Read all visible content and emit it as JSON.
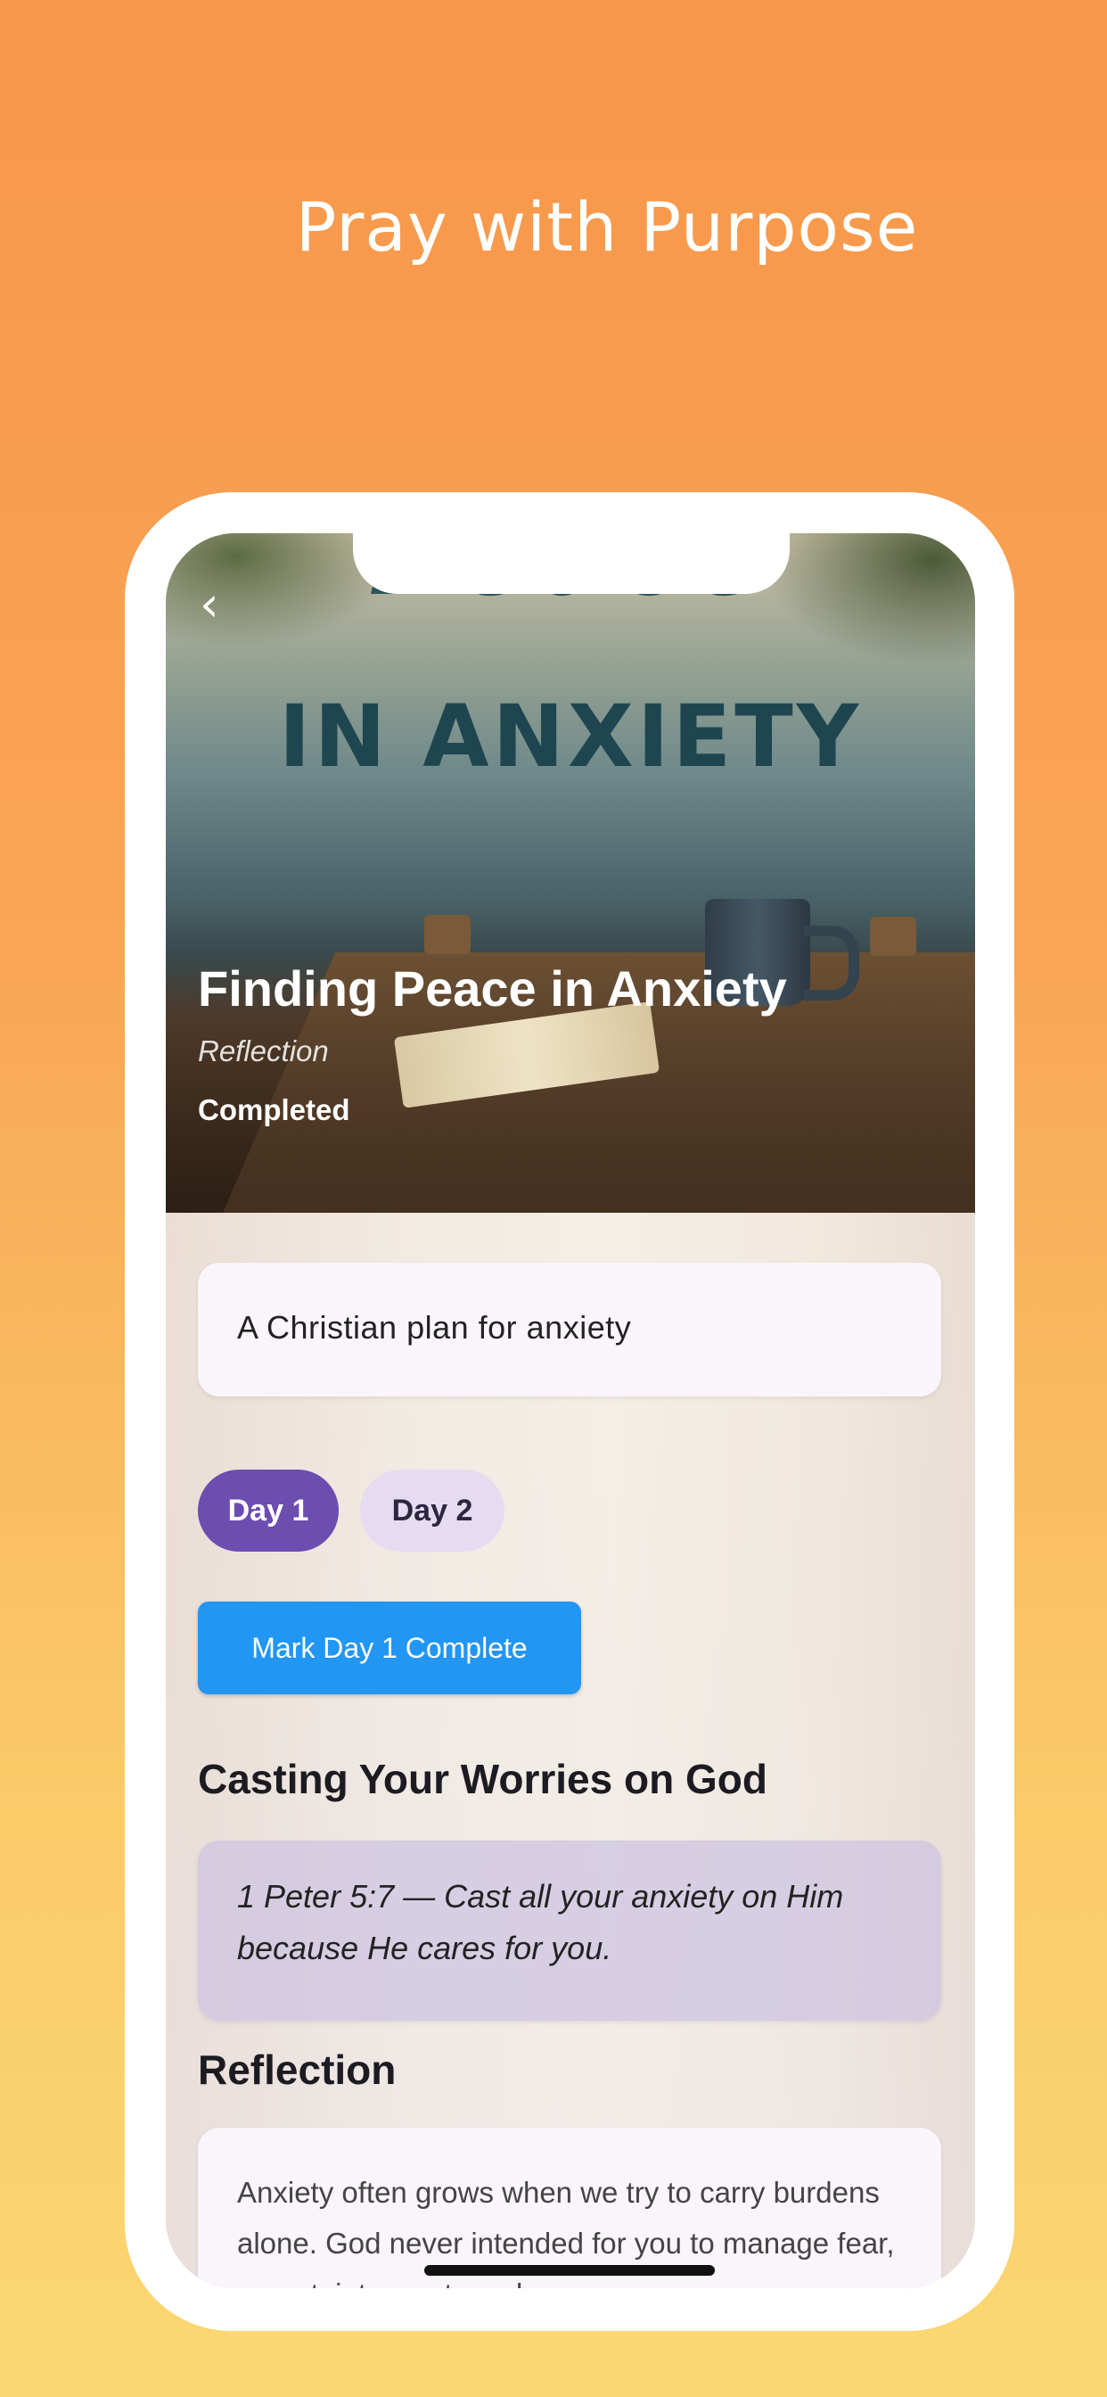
{
  "promo": {
    "title": "Pray with Purpose"
  },
  "hero": {
    "image_script_text": "Peace",
    "image_headline": "IN ANXIETY",
    "title": "Finding Peace in Anxiety",
    "subtitle": "Reflection",
    "status": "Completed",
    "back_icon": "chevron-left-icon"
  },
  "plan": {
    "description": "A Christian plan for anxiety",
    "days": [
      "Day 1",
      "Day 2"
    ],
    "selected_day": "Day 1",
    "mark_complete_label": "Mark Day 1 Complete"
  },
  "sections": {
    "verse_title": "Casting Your Worries on God",
    "verse_text": "1 Peter 5:7 — Cast all your anxiety on Him because He cares for you.",
    "reflection_title": "Reflection",
    "reflection_text": "Anxiety often grows when we try to carry burdens alone. God never intended for you to manage fear, uncertainty, or stress by"
  },
  "colors": {
    "background_top": "#F8964A",
    "background_bottom": "#FBD772",
    "day_selected": "#6C4DB0",
    "day_unselected": "#E5DCF1",
    "primary_button": "#2196F3"
  }
}
